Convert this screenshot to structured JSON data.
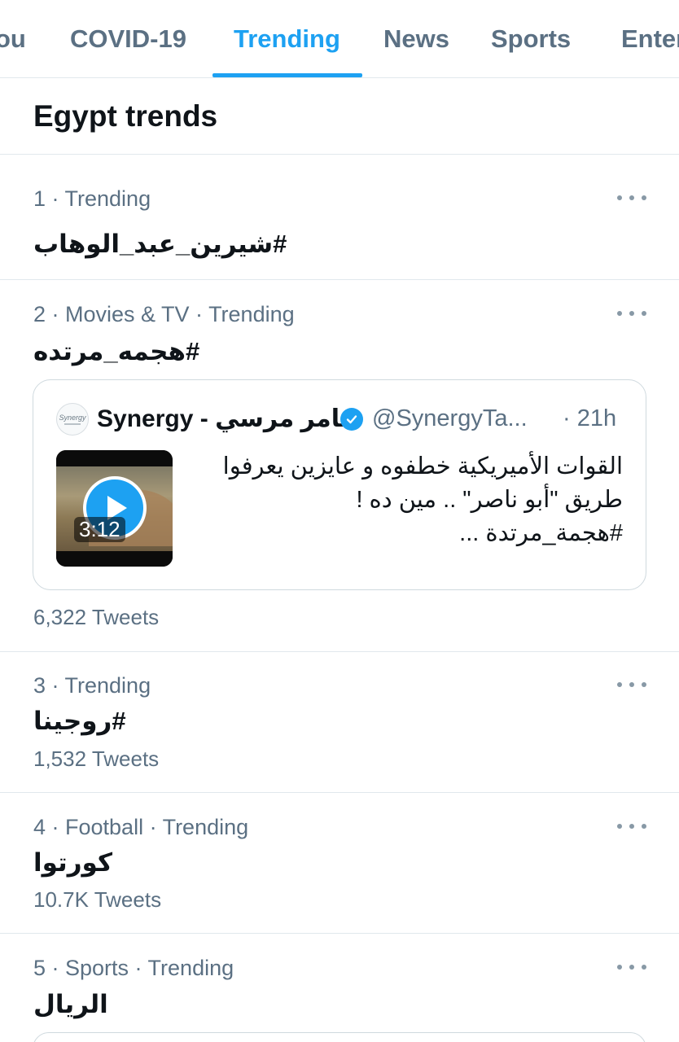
{
  "tabs": [
    {
      "label": "ou",
      "active": false
    },
    {
      "label": "COVID-19",
      "active": false
    },
    {
      "label": "Trending",
      "active": true
    },
    {
      "label": "News",
      "active": false
    },
    {
      "label": "Sports",
      "active": false
    },
    {
      "label": "Enter",
      "active": false
    }
  ],
  "section_title": "Egypt trends",
  "trends": [
    {
      "meta": "1 · Trending",
      "name": "#شيرين_عبد_الوهاب",
      "count": ""
    },
    {
      "meta": "2 · Movies & TV · Trending",
      "name": "#هجمه_مرتده",
      "count": "6,322 Tweets"
    },
    {
      "meta": "3 · Trending",
      "name": "#روجينا",
      "count": "1,532 Tweets"
    },
    {
      "meta": "4 · Football · Trending",
      "name": "كورتوا",
      "count": "10.7K Tweets"
    },
    {
      "meta": "5 · Sports · Trending",
      "name": "الريال",
      "count": ""
    }
  ],
  "tweet": {
    "avatar_text": "Synergy",
    "author": "Synergy - تامر مرسي",
    "handle": "@SynergyTa...",
    "time": "· 21h",
    "duration": "3:12",
    "text_lines": [
      "القوات الأميريكية خطفوه و عايزين يعرفوا",
      "طريق \"أبو ناصر\" .. مين ده !",
      "#هجمة_مرتدة ..."
    ]
  },
  "colors": {
    "accent": "#1da1f2",
    "secondary_text": "#5b7083",
    "divider": "#e1e8ed"
  },
  "icons": {
    "more": "more-horizontal-icon",
    "verified": "verified-badge-icon",
    "play": "play-icon"
  }
}
